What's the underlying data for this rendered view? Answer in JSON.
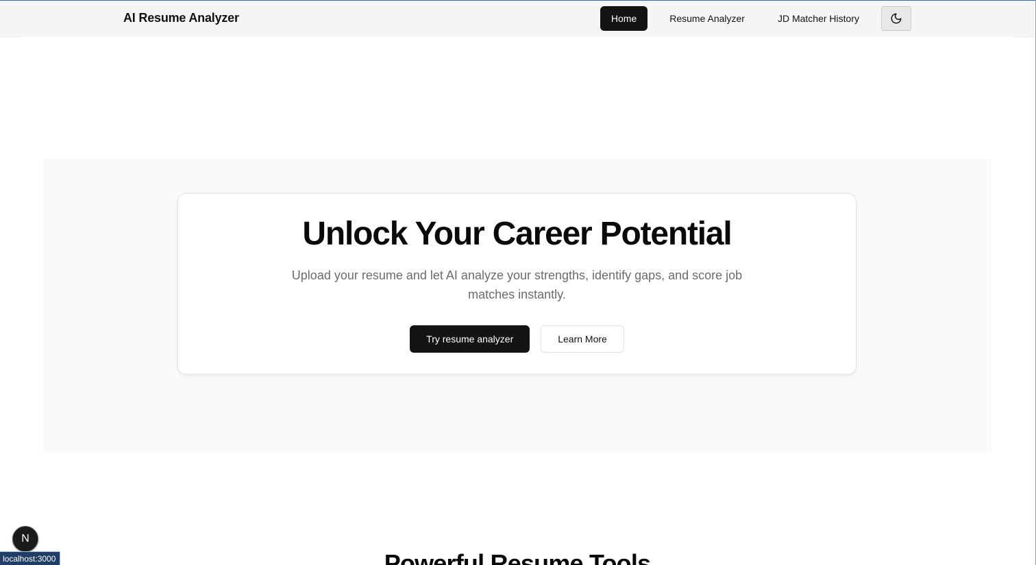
{
  "navbar": {
    "brand": "AI Resume Analyzer",
    "links": [
      {
        "label": "Home",
        "active": true
      },
      {
        "label": "Resume Analyzer",
        "active": false
      },
      {
        "label": "JD Matcher History",
        "active": false
      }
    ],
    "theme_toggle_icon": "moon-icon"
  },
  "hero": {
    "title": "Unlock Your Career Potential",
    "subtitle": "Upload your resume and let AI analyze your strengths, identify gaps, and score job matches instantly.",
    "primary_button": "Try resume analyzer",
    "secondary_button": "Learn More"
  },
  "section": {
    "title": "Powerful Resume Tools"
  },
  "dev_indicator": {
    "letter": "N",
    "icon": "nextjs-icon"
  },
  "status_bar": {
    "url": "localhost:3000"
  },
  "colors": {
    "primary": "#141414",
    "hero_bg": "#f9fafb",
    "navbar_bg": "#f5f5f5",
    "muted_text": "#6b6b6b"
  }
}
